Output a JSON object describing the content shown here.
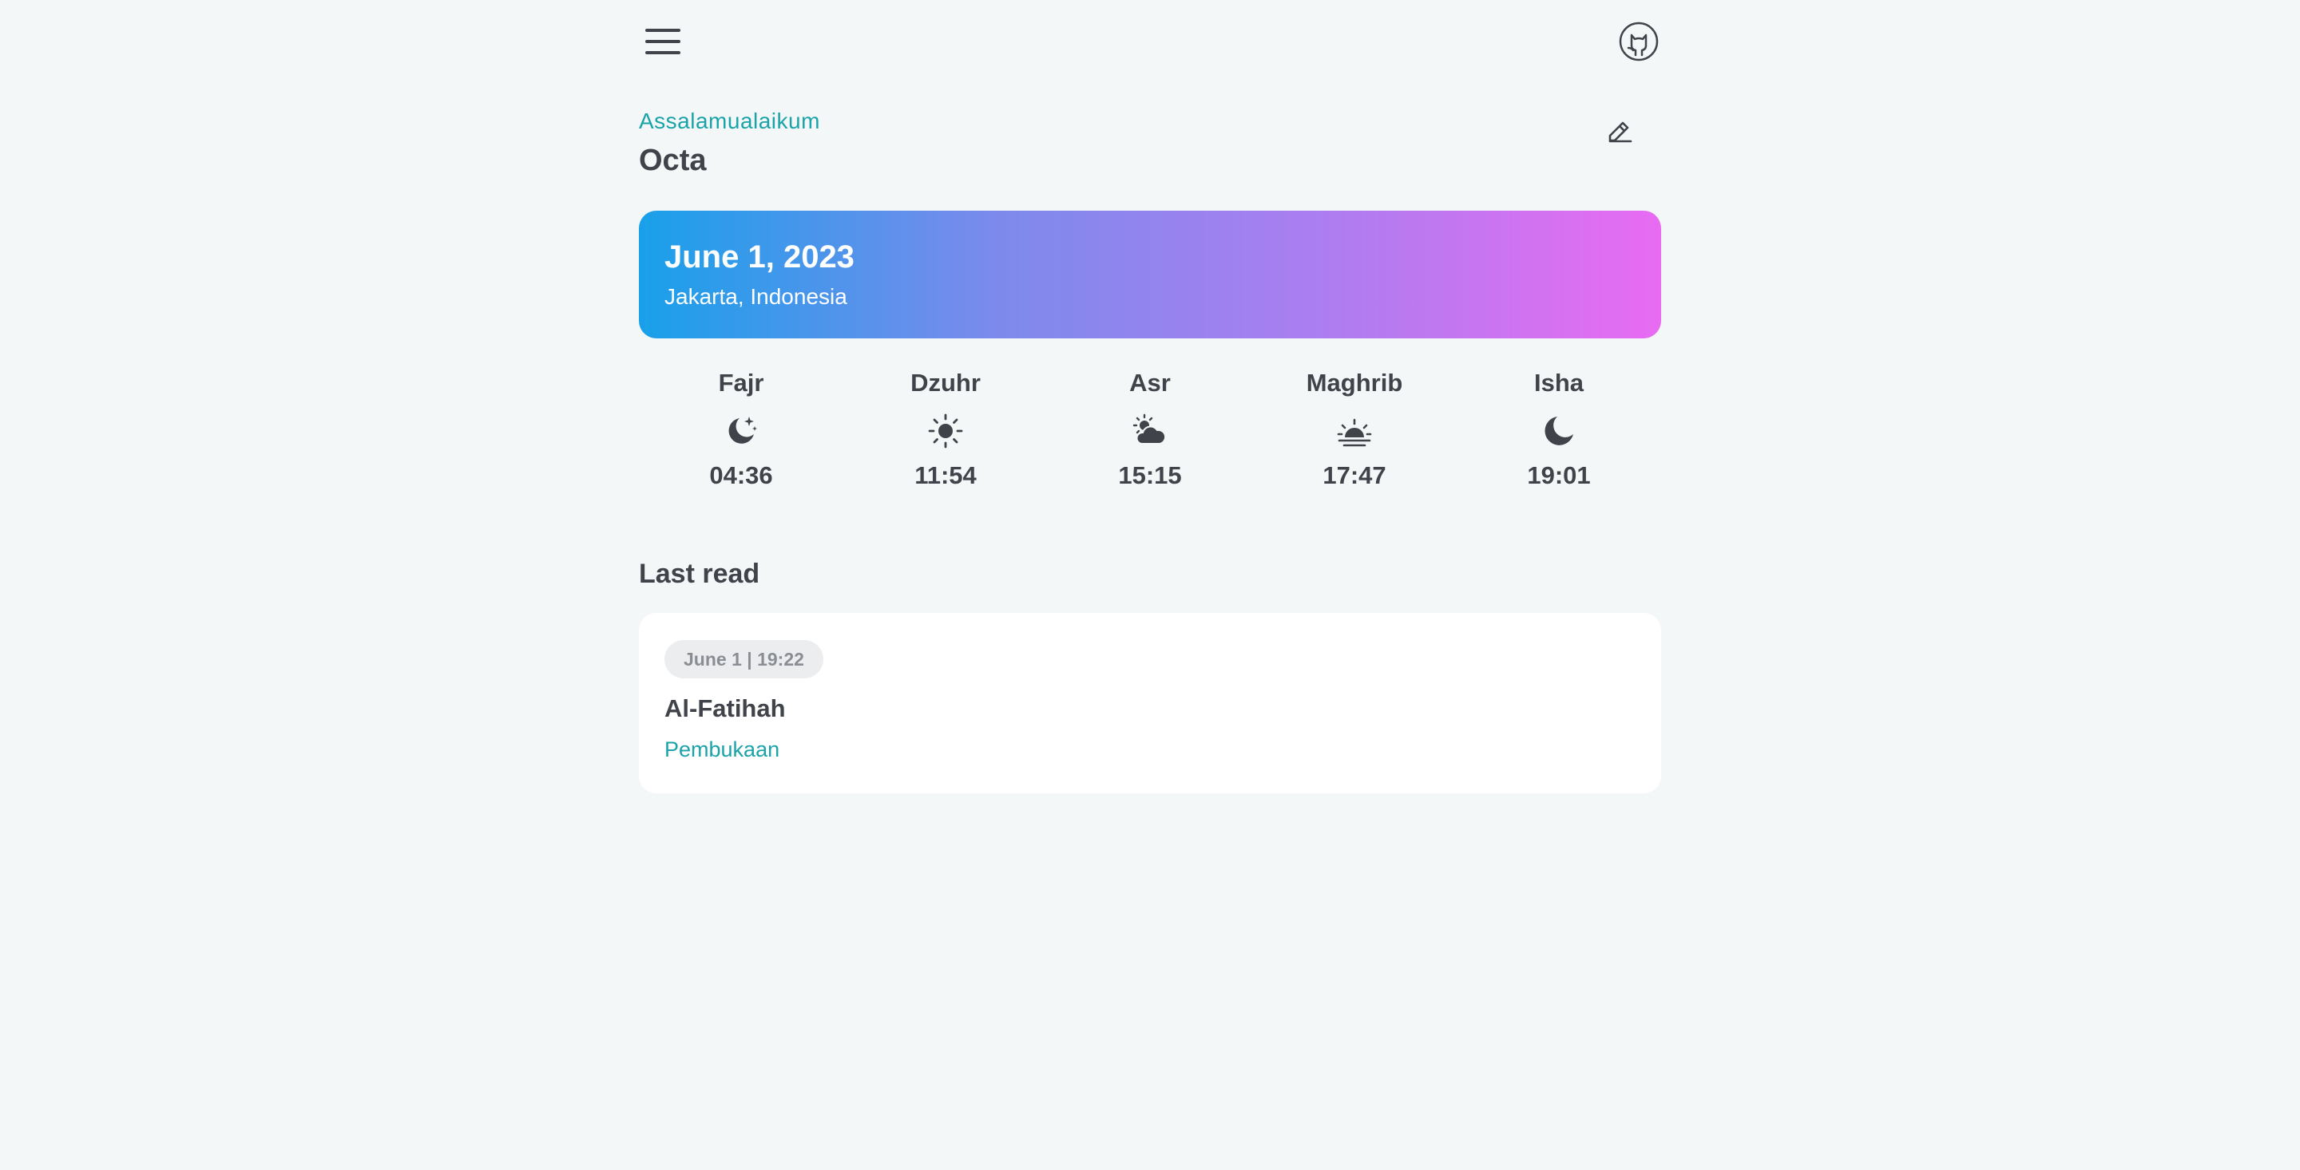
{
  "header": {
    "menu_icon": "hamburger-menu-icon",
    "github_icon": "github-icon"
  },
  "greeting": {
    "salutation": "Assalamualaikum",
    "name": "Octa",
    "edit_icon": "pencil-edit-icon"
  },
  "date_card": {
    "date": "June 1, 2023",
    "location": "Jakarta, Indonesia",
    "gradient_start": "#19a0ea",
    "gradient_end": "#e86bf2"
  },
  "prayers": [
    {
      "name": "Fajr",
      "time": "04:36",
      "icon": "moon-stars-icon"
    },
    {
      "name": "Dzuhr",
      "time": "11:54",
      "icon": "sun-icon"
    },
    {
      "name": "Asr",
      "time": "15:15",
      "icon": "cloud-sun-icon"
    },
    {
      "name": "Maghrib",
      "time": "17:47",
      "icon": "sunset-icon"
    },
    {
      "name": "Isha",
      "time": "19:01",
      "icon": "moon-icon"
    }
  ],
  "last_read": {
    "title": "Last read",
    "timestamp": "June 1 | 19:22",
    "surah": "Al-Fatihah",
    "meaning": "Pembukaan"
  },
  "colors": {
    "accent": "#1aa3a8",
    "text": "#404349",
    "background": "#f3f7f8"
  }
}
